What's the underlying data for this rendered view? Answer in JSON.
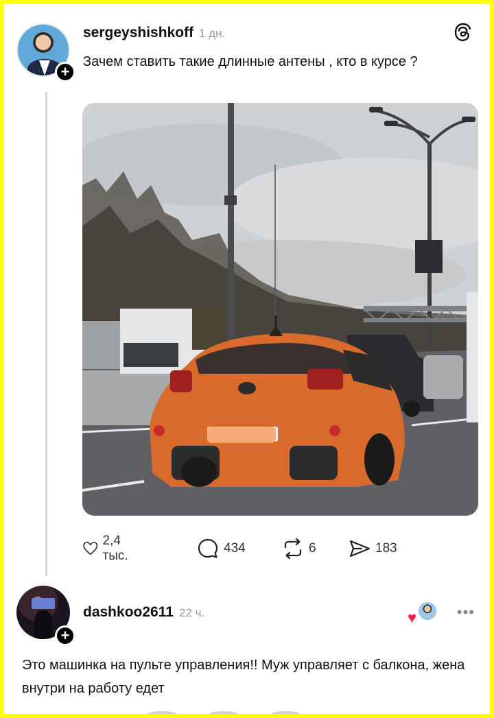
{
  "post": {
    "username": "sergeyshishkoff",
    "time": "1 дн.",
    "text": "Зачем ставить такие длинные антены , кто в курсе ?",
    "image_alt": "orange hatchback on a highway with a long antenna"
  },
  "actions": {
    "likes": "2,4 тыс.",
    "comments": "434",
    "reposts": "6",
    "shares": "183"
  },
  "reply": {
    "username": "dashkoo2611",
    "time": "22 ч.",
    "text": "Это машинка на пульте управления!! Муж управляет с балкона, жена внутри на работу едет"
  },
  "icons": {
    "threads": "threads-logo-icon",
    "like": "heart-icon",
    "comment": "comment-icon",
    "repost": "repost-icon",
    "share": "share-icon",
    "more": "more-icon",
    "follow": "plus-icon"
  },
  "colors": {
    "frame": "#ffff00",
    "like_heart": "#ff1a45",
    "car": "#d86a2c"
  }
}
